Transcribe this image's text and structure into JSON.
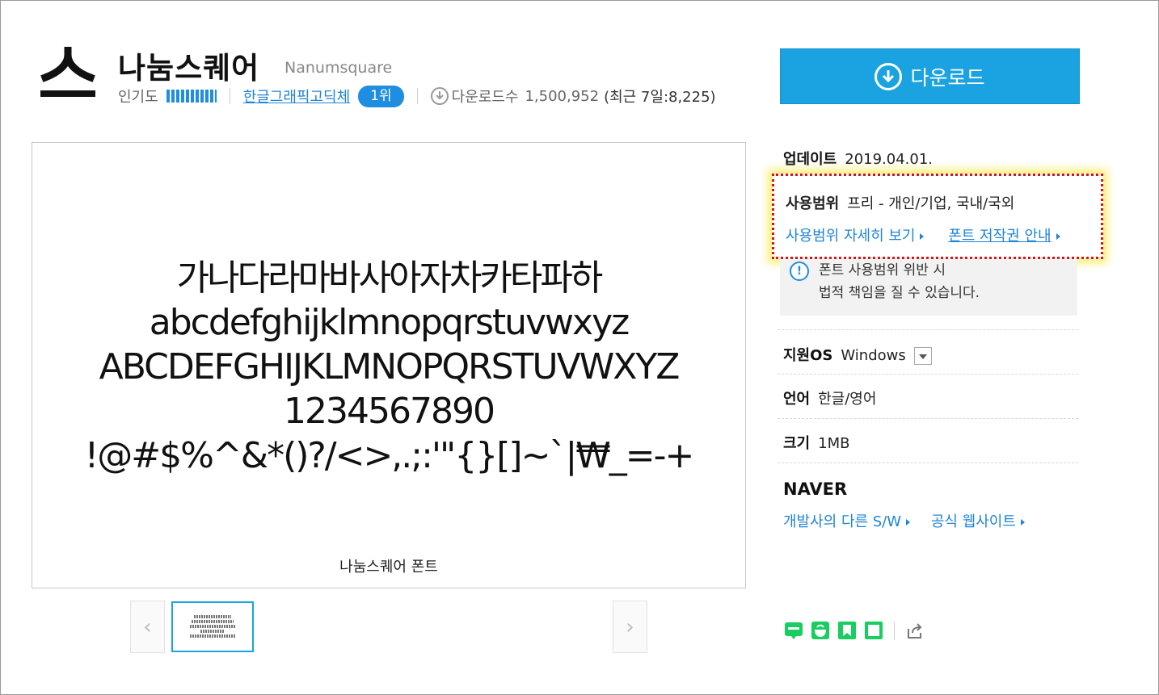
{
  "header": {
    "logo_glyph": "스",
    "title": "나눔스퀘어",
    "title_en": "Nanumsquare",
    "popularity_label": "인기도",
    "category_link": "한글그래픽고딕체",
    "rank_badge": "1위",
    "download_count_label": "다운로드수",
    "download_count": "1,500,952",
    "recent_downloads": "(최근 7일:8,225)",
    "download_button": "다운로드"
  },
  "preview": {
    "lines": [
      "가나다라마바사아자차카타파하",
      "abcdefghijklmnopqrstuvwxyz",
      "ABCDEFGHIJKLMNOPQRSTUVWXYZ",
      "1234567890",
      "!@#$%^&*()?/<>,.;:'\"{}[]~`|₩_=-+"
    ],
    "caption": "나눔스퀘어 폰트",
    "prev_arrow": "‹",
    "next_arrow": "›"
  },
  "info": {
    "update_label": "업데이트",
    "update_value": "2019.04.01.",
    "usage_label": "사용범위",
    "usage_value": "프리 - 개인/기업, 국내/국외",
    "usage_detail_link": "사용범위 자세히 보기",
    "copyright_link": "폰트 저작권 안내",
    "warning_line1": "폰트 사용범위 위반 시",
    "warning_line2": "법적 책임을 질 수 있습니다.",
    "os_label": "지원OS",
    "os_value": "Windows",
    "lang_label": "언어",
    "lang_value": "한글/영어",
    "size_label": "크기",
    "size_value": "1MB",
    "vendor": "NAVER",
    "vendor_other_link": "개발사의 다른 S/W",
    "vendor_site_link": "공식 웹사이트"
  },
  "share": {
    "icons": [
      "blog-icon",
      "cafe-icon",
      "bookmark-icon",
      "memo-icon",
      "share-icon"
    ],
    "brand_green": "#19ce60",
    "accent_blue": "#1aa3e0"
  }
}
